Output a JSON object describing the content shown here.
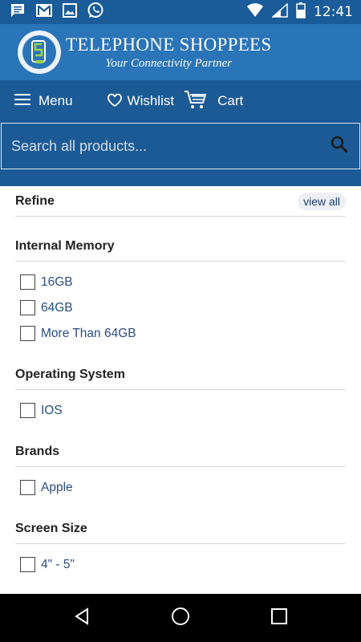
{
  "status_bar": {
    "time": "12:41",
    "left_icons": [
      "chat-icon",
      "gmail-icon",
      "image-icon",
      "whatsapp-icon"
    ],
    "right_icons": [
      "wifi-icon",
      "signal-icon",
      "battery-icon"
    ]
  },
  "brand": {
    "title": "TELEPHONE SHOPPEES",
    "tagline": "Your Connectivity Partner"
  },
  "nav": {
    "menu_label": "Menu",
    "wishlist_label": "Wishlist",
    "cart_label": "Cart"
  },
  "search": {
    "placeholder": "Search all products..."
  },
  "refine": {
    "title": "Refine",
    "view_all": "view all"
  },
  "filters": {
    "internal_memory": {
      "title": "Internal Memory",
      "options": [
        "16GB",
        "64GB",
        "More Than 64GB"
      ]
    },
    "operating_system": {
      "title": "Operating System",
      "options": [
        "IOS"
      ]
    },
    "brands": {
      "title": "Brands",
      "options": [
        "Apple"
      ]
    },
    "screen_size": {
      "title": "Screen Size",
      "options": [
        "4\" - 5\""
      ]
    }
  },
  "colors": {
    "status_bar": "#1a5c9a",
    "brand_bg": "#2a74b8",
    "nav_bg": "#1b5a95",
    "link": "#2a4d83"
  }
}
